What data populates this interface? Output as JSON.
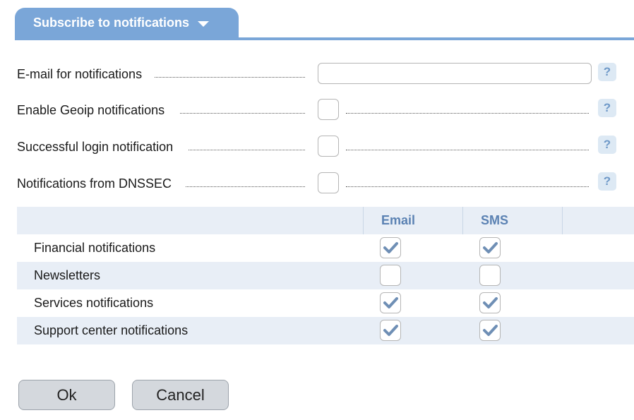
{
  "tab": {
    "label": "Subscribe to notifications"
  },
  "form": {
    "email_label": "E-mail for notifications",
    "email_value": "",
    "geoip_label": "Enable Geoip notifications",
    "geoip_checked": false,
    "login_label": "Successful login notification",
    "login_checked": false,
    "dnssec_label": "Notifications from DNSSEC",
    "dnssec_checked": false,
    "help_text": "?"
  },
  "table": {
    "columns": [
      "Email",
      "SMS"
    ],
    "rows": [
      {
        "name": "Financial notifications",
        "email": true,
        "sms": true
      },
      {
        "name": "Newsletters",
        "email": false,
        "sms": false
      },
      {
        "name": "Services notifications",
        "email": true,
        "sms": true
      },
      {
        "name": "Support center notifications",
        "email": true,
        "sms": true
      }
    ]
  },
  "buttons": {
    "ok": "Ok",
    "cancel": "Cancel"
  },
  "colors": {
    "accent": "#7aa6d8",
    "check": "#6f8fb5",
    "row_alt": "#e8eef6"
  }
}
